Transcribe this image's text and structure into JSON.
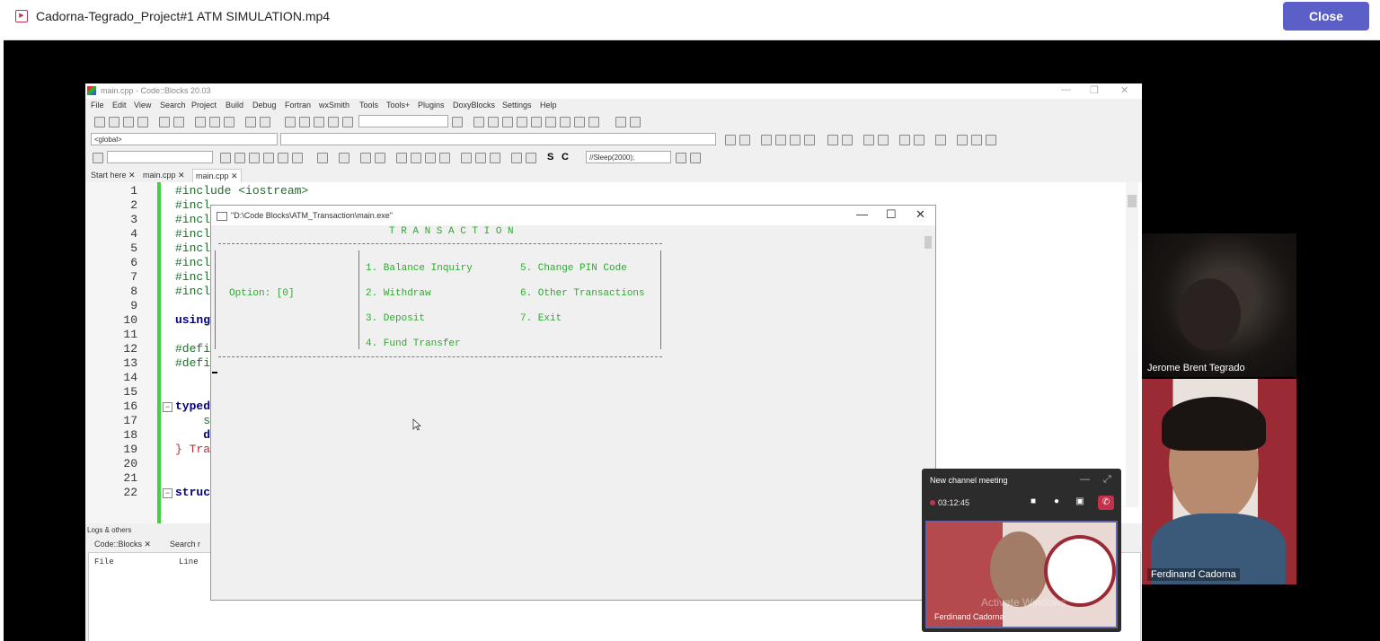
{
  "viewer": {
    "file_name": "Cadorna-Tegrado_Project#1 ATM SIMULATION.mp4",
    "close_label": "Close"
  },
  "codeblocks": {
    "title": "main.cpp - Code::Blocks 20.03",
    "window_controls": [
      "—",
      "❐",
      "✕"
    ],
    "menu": [
      "File",
      "Edit",
      "View",
      "Search",
      "Project",
      "Build",
      "Debug",
      "Fortran",
      "wxSmith",
      "Tools",
      "Tools+",
      "Plugins",
      "DoxyBlocks",
      "Settings",
      "Help"
    ],
    "scope_combo": "<global>",
    "search_combo": "//Sleep(2000);",
    "tabs": [
      "Start here",
      "main.cpp",
      "main.cpp"
    ],
    "lines": [
      {
        "n": "1",
        "code": "#include <iostream>"
      },
      {
        "n": "2",
        "code": "#incl"
      },
      {
        "n": "3",
        "code": "#incl"
      },
      {
        "n": "4",
        "code": "#incl"
      },
      {
        "n": "5",
        "code": "#incl"
      },
      {
        "n": "6",
        "code": "#incl"
      },
      {
        "n": "7",
        "code": "#incl"
      },
      {
        "n": "8",
        "code": "#incl"
      },
      {
        "n": "9",
        "code": ""
      },
      {
        "n": "10",
        "code": "using"
      },
      {
        "n": "11",
        "code": ""
      },
      {
        "n": "12",
        "code": "#defi"
      },
      {
        "n": "13",
        "code": "#defi"
      },
      {
        "n": "14",
        "code": ""
      },
      {
        "n": "15",
        "code": ""
      },
      {
        "n": "16",
        "code": "typed"
      },
      {
        "n": "17",
        "code": "    s"
      },
      {
        "n": "18",
        "code": "    d"
      },
      {
        "n": "19",
        "code": "} Tra"
      },
      {
        "n": "20",
        "code": ""
      },
      {
        "n": "21",
        "code": ""
      },
      {
        "n": "22",
        "code": "struc"
      }
    ],
    "logs": {
      "header": "Logs & others",
      "tabs": [
        "Code::Blocks",
        "Search r"
      ],
      "columns": [
        "File",
        "Line"
      ]
    }
  },
  "console": {
    "title": "\"D:\\Code Blocks\\ATM_Transaction\\main.exe\"",
    "window_controls": [
      "—",
      "☐",
      "✕"
    ],
    "heading": "T R A N S A C T I O N",
    "option_label": "Option: [0]",
    "options": [
      "1. Balance Inquiry",
      "2. Withdraw",
      "3. Deposit",
      "4. Fund Transfer",
      "5. Change PIN Code",
      "6. Other Transactions",
      "7. Exit"
    ]
  },
  "participants": [
    {
      "name": "Jerome Brent Tegrado"
    },
    {
      "name": "Ferdinand Cadorna"
    }
  ],
  "meeting": {
    "title": "New channel meeting",
    "elapsed": "03:12:45",
    "self_name": "Ferdinand Cadorna",
    "watermark": "Activate Windows"
  },
  "colors": {
    "accent": "#5b5fc7",
    "console_text": "#2eaa2e",
    "hangup": "#c4314b"
  }
}
